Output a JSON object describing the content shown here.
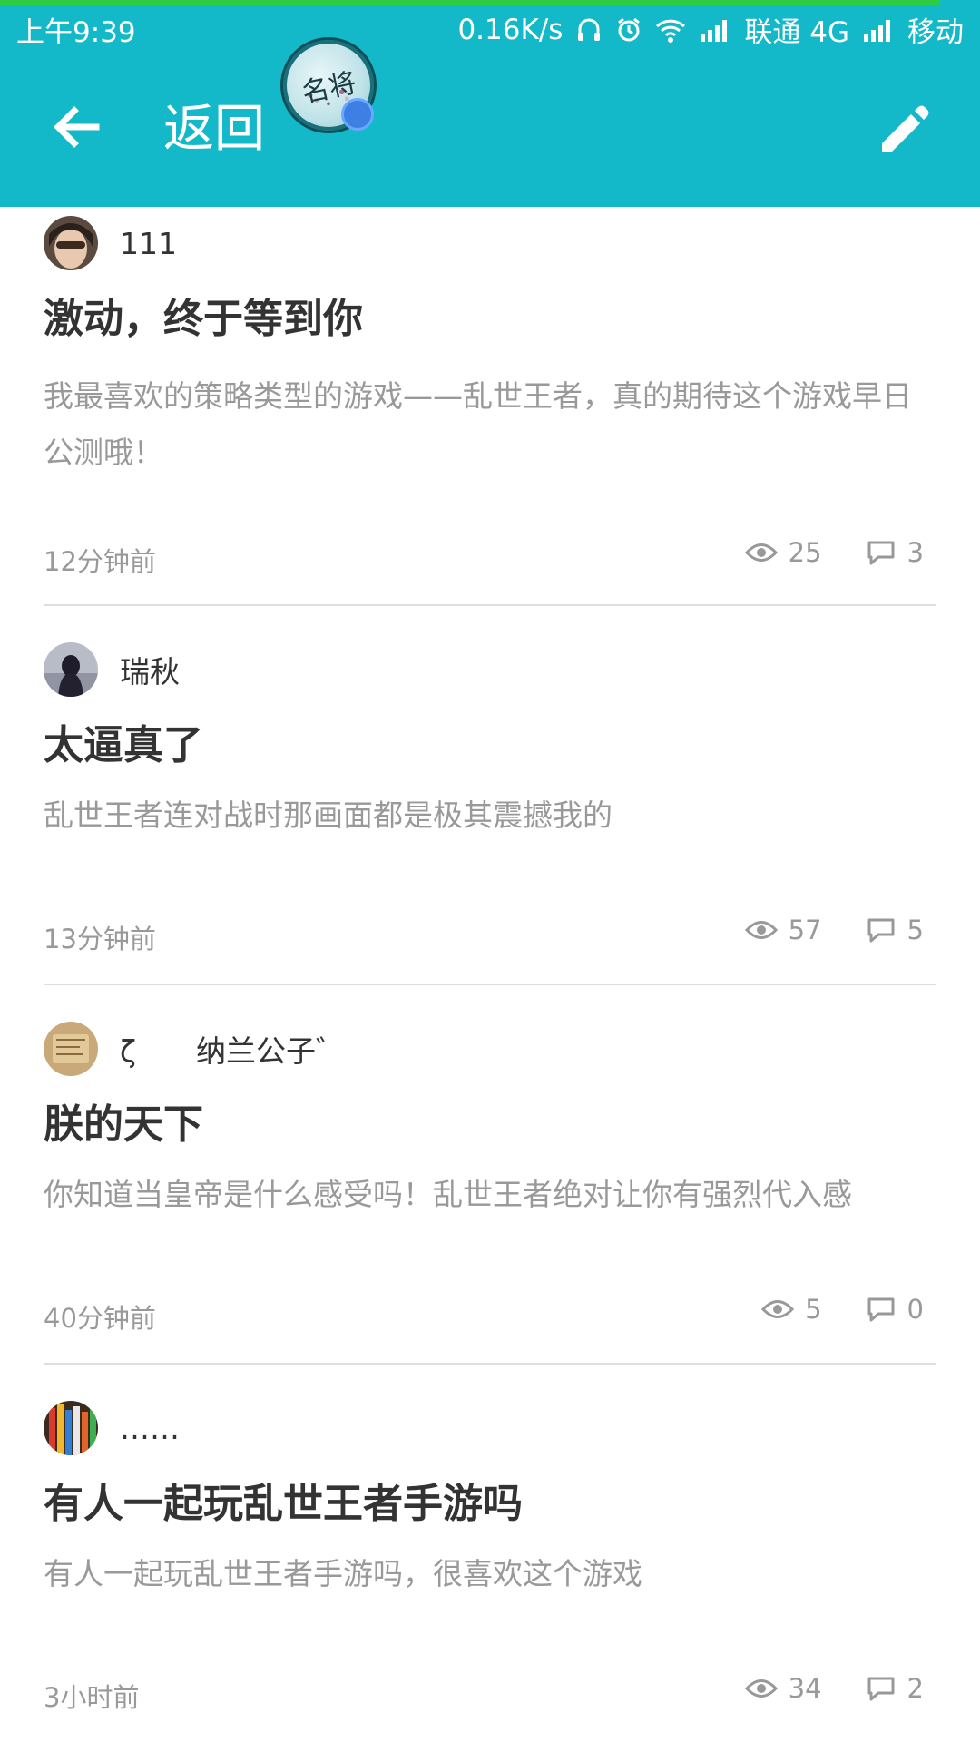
{
  "status_bar": {
    "time": "上午9:39",
    "net_speed": "0.16K/s",
    "carrier1": "联通 4G",
    "carrier2": "移动",
    "icons": [
      "headset-icon",
      "alarm-icon",
      "wifi-icon",
      "signal-icon",
      "signal-icon"
    ]
  },
  "app_bar": {
    "back_label": "返回",
    "logo_text": "名将",
    "back_icon": "arrow-left-icon",
    "edit_icon": "pencil-icon",
    "color": "#14b9c9"
  },
  "posts": [
    {
      "author": "111",
      "title": "激动，终于等到你",
      "body": "我最喜欢的策略类型的游戏——乱世王者，真的期待这个游戏早日公测哦！",
      "time": "12分钟前",
      "views": "25",
      "comments": "3"
    },
    {
      "author": "瑞秋",
      "title": "太逼真了",
      "body": "乱世王者连对战时那画面都是极其震撼我的",
      "time": "13分钟前",
      "views": "57",
      "comments": "5"
    },
    {
      "author": "ζ　　纳兰公子゛",
      "title": "朕的天下",
      "body": "你知道当皇帝是什么感受吗！乱世王者绝对让你有强烈代入感",
      "time": "40分钟前",
      "views": "5",
      "comments": "0"
    },
    {
      "author": "……",
      "title": "有人一起玩乱世王者手游吗",
      "body": "有人一起玩乱世王者手游吗，很喜欢这个游戏",
      "time": "3小时前",
      "views": "34",
      "comments": "2"
    }
  ]
}
